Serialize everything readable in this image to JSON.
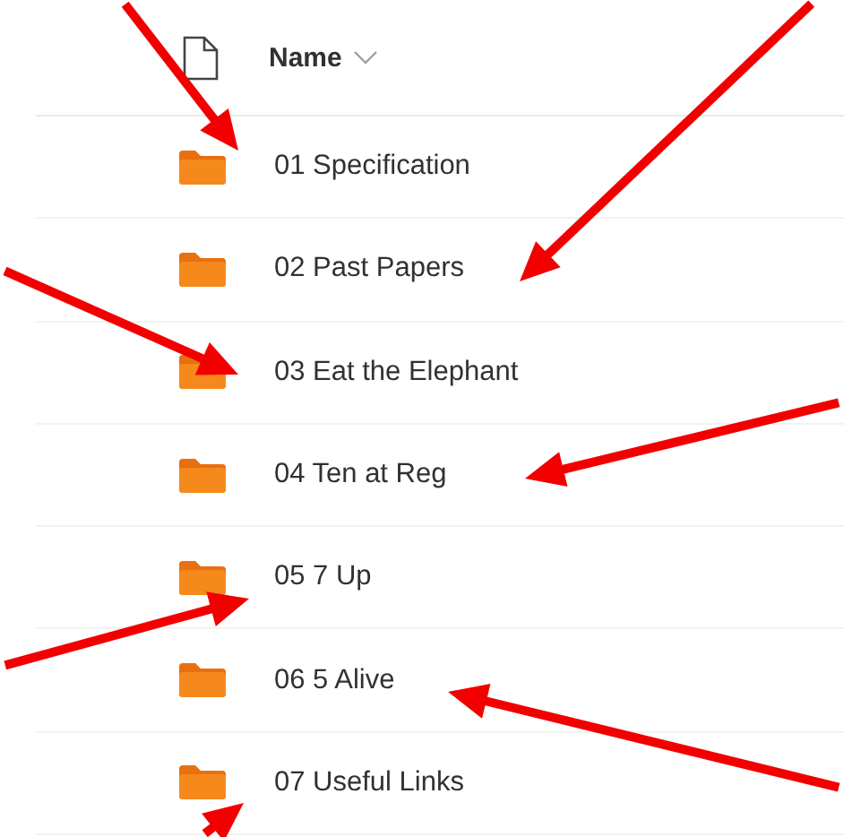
{
  "header": {
    "column": "Name"
  },
  "folders": [
    {
      "name": "01 Specification",
      "arrow": true
    },
    {
      "name": "02 Past Papers",
      "arrow": true
    },
    {
      "name": "03 Eat the Elephant",
      "arrow": true
    },
    {
      "name": "04 Ten at Reg",
      "arrow": true
    },
    {
      "name": "05 7 Up",
      "arrow": true
    },
    {
      "name": "06 5 Alive",
      "arrow": true
    },
    {
      "name": "07 Useful Links",
      "arrow": true
    }
  ]
}
